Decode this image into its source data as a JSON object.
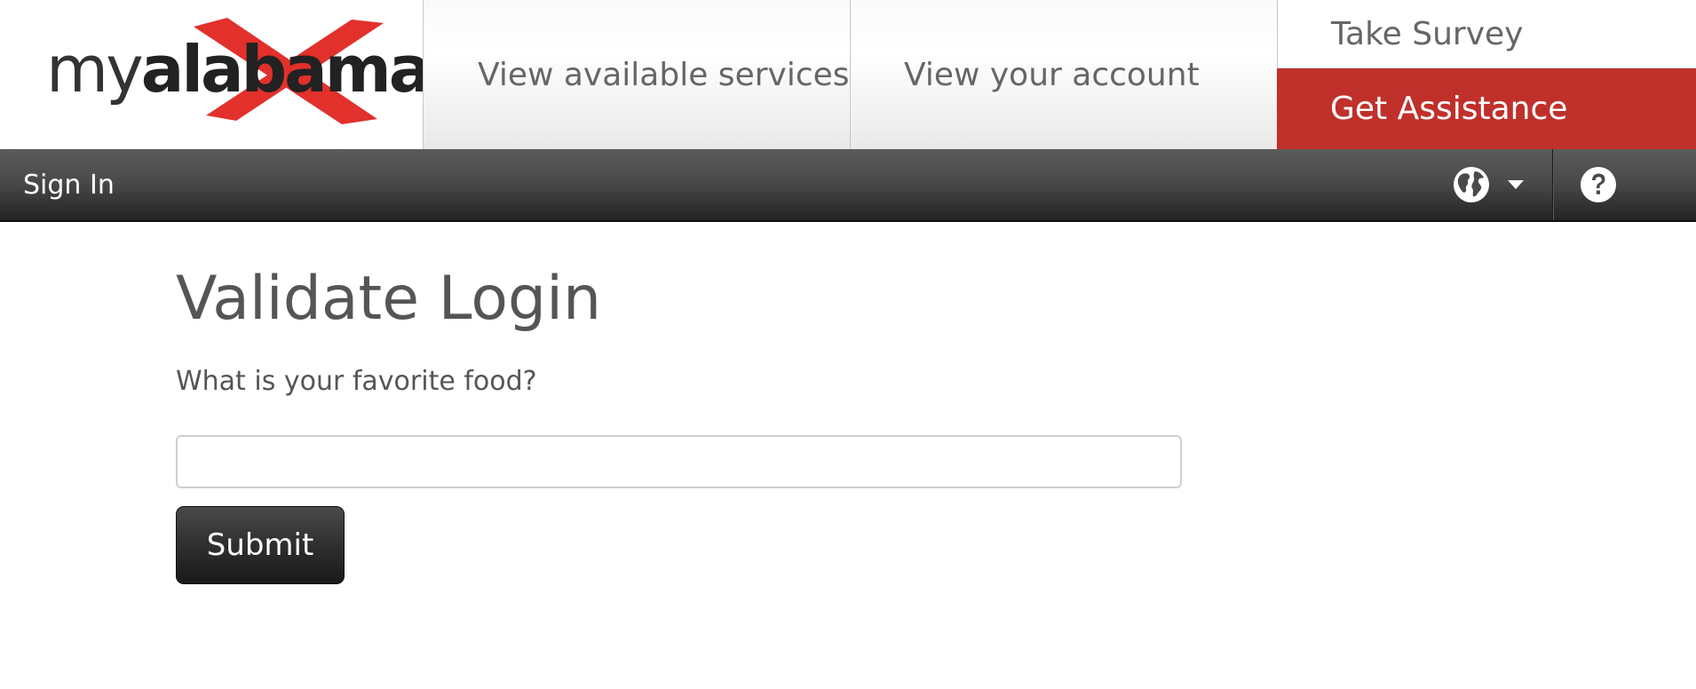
{
  "header": {
    "logo": {
      "text_prefix": "my",
      "text_bold": "alabama",
      "accent_color": "#e2302b"
    },
    "nav": {
      "services_label": "View available services",
      "account_label": "View your account",
      "survey_label": "Take Survey",
      "assistance_label": "Get Assistance"
    },
    "colors": {
      "assistance_bg": "#c0302b"
    }
  },
  "toolbar": {
    "signin_label": "Sign In",
    "language_icon": "globe-icon",
    "language_caret_icon": "caret-down-icon",
    "help_icon": "question-circle-icon"
  },
  "main": {
    "title": "Validate Login",
    "question": "What is your favorite food?",
    "answer_value": "",
    "submit_label": "Submit"
  }
}
